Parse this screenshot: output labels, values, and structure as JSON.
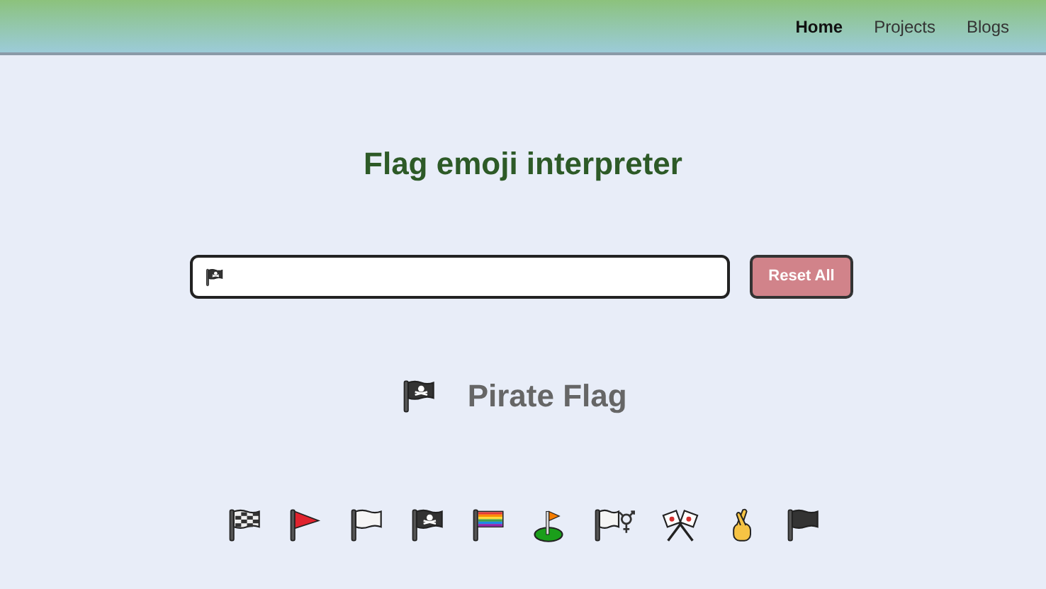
{
  "nav": [
    {
      "label": "Home",
      "selected": true
    },
    {
      "label": "Projects",
      "selected": false
    },
    {
      "label": "Blogs",
      "selected": false
    }
  ],
  "title": "Flag emoji interpreter",
  "search": {
    "kind": "pirate"
  },
  "reset_button": "Reset All",
  "result": {
    "kind": "pirate",
    "meaning": "Pirate Flag"
  },
  "emojis": [
    {
      "kind": "checkered"
    },
    {
      "kind": "triangular"
    },
    {
      "kind": "white"
    },
    {
      "kind": "pirate"
    },
    {
      "kind": "rainbow"
    },
    {
      "kind": "golf"
    },
    {
      "kind": "transgender"
    },
    {
      "kind": "crossed"
    },
    {
      "kind": "fingers"
    },
    {
      "kind": "black"
    }
  ]
}
